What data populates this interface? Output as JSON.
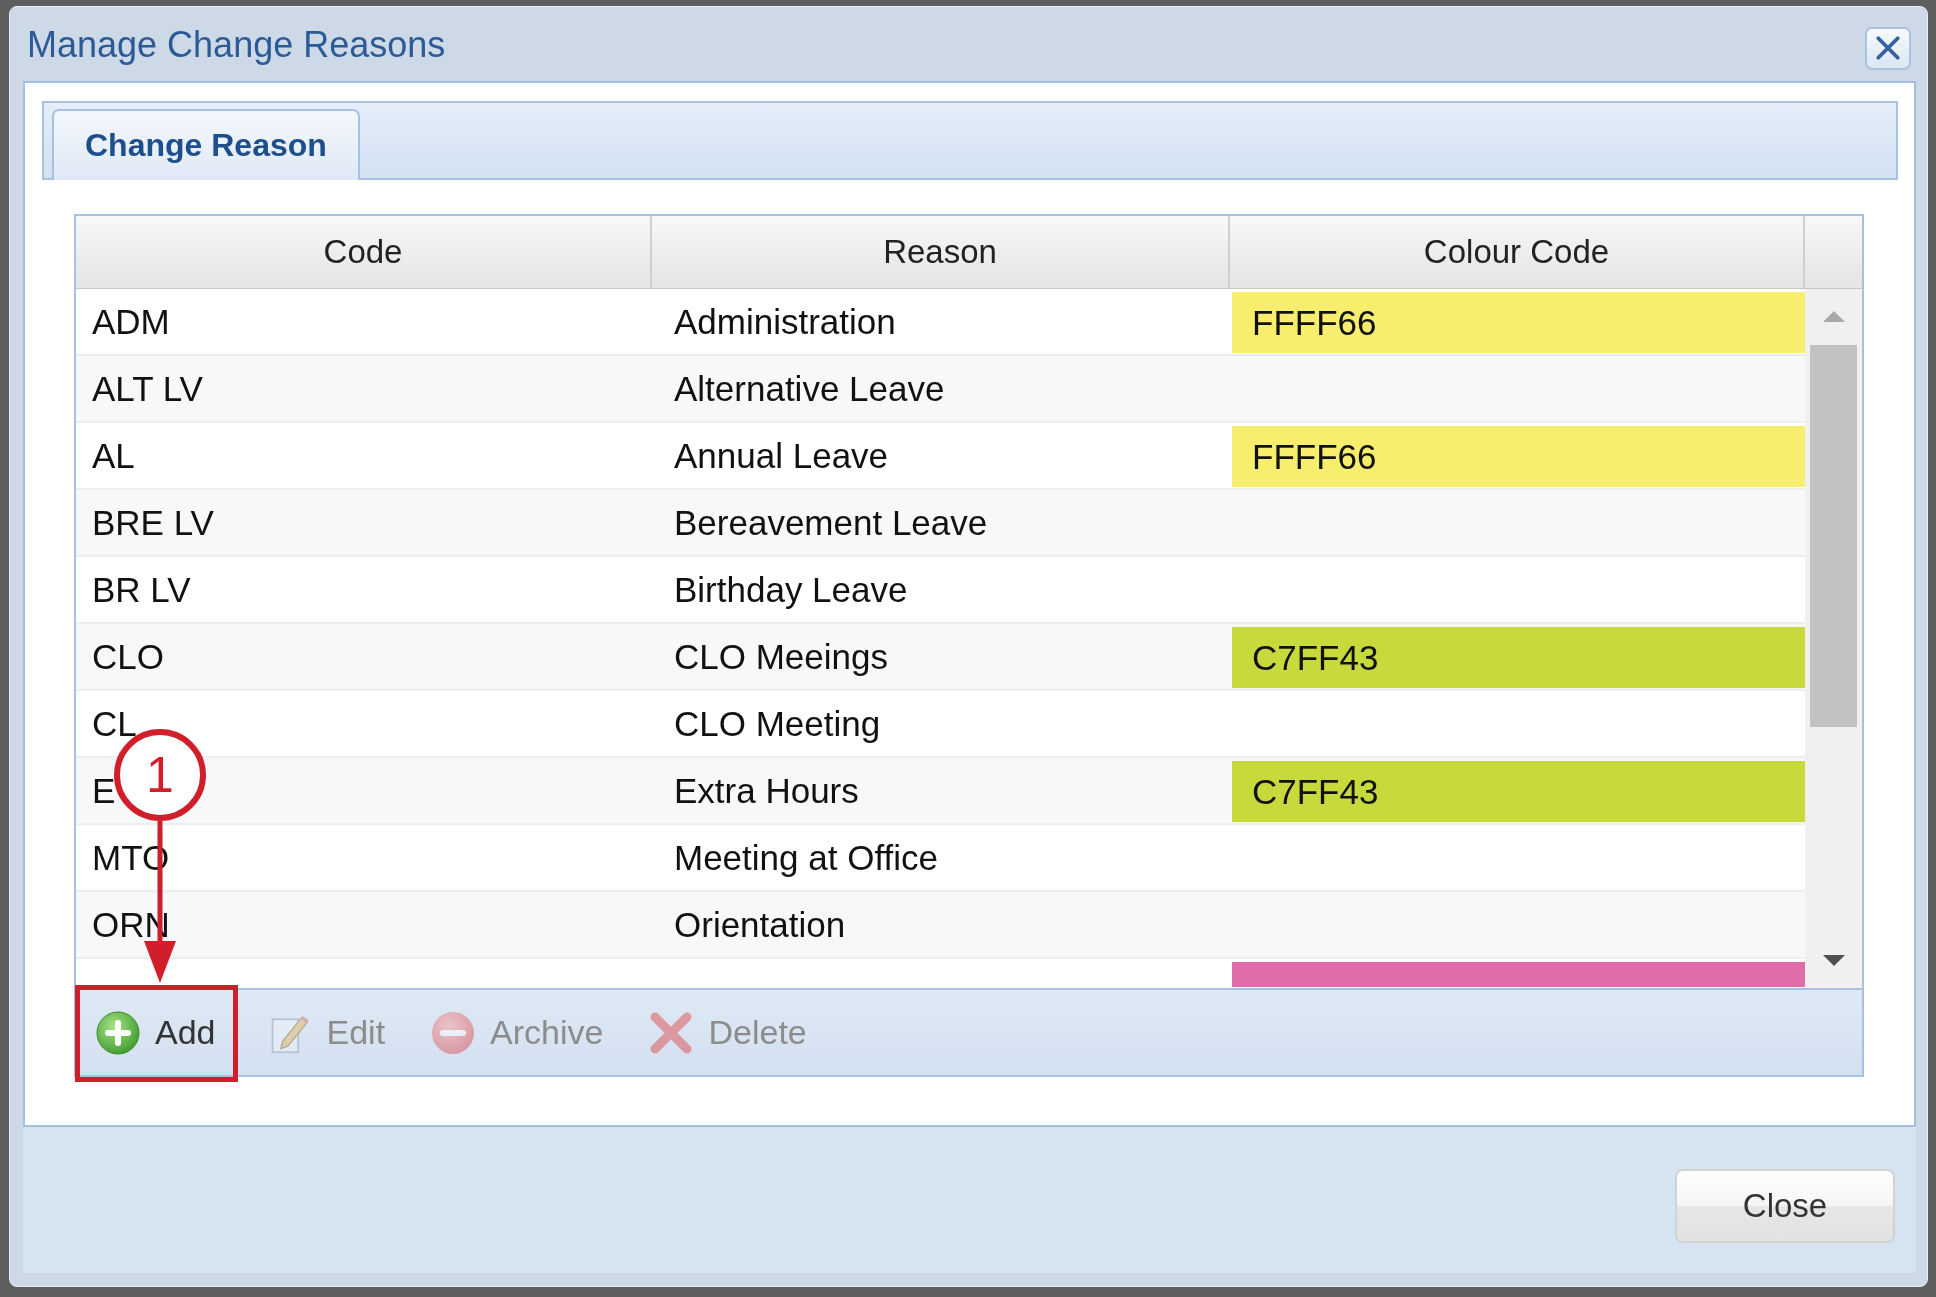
{
  "window": {
    "title": "Manage Change Reasons"
  },
  "tabs": [
    {
      "label": "Change Reason",
      "selected": true
    }
  ],
  "table": {
    "columns": [
      "Code",
      "Reason",
      "Colour Code"
    ],
    "rows": [
      {
        "code": "ADM",
        "reason": "Administration",
        "colour_code": "FFFF66",
        "color": "#f8ee6e"
      },
      {
        "code": "ALT LV",
        "reason": "Alternative Leave"
      },
      {
        "code": "AL",
        "reason": "Annual Leave",
        "colour_code": "FFFF66",
        "color": "#f8ee6e"
      },
      {
        "code": "BRE LV",
        "reason": "Bereavement Leave"
      },
      {
        "code": "BR LV",
        "reason": "Birthday Leave"
      },
      {
        "code": "CLO",
        "reason": "CLO Meeings",
        "colour_code": "C7FF43",
        "color": "#c8da3b"
      },
      {
        "code": "CL",
        "reason": "CLO Meeting"
      },
      {
        "code": "E",
        "reason": "Extra Hours",
        "colour_code": "C7FF43",
        "color": "#c8da3b"
      },
      {
        "code": "MTO",
        "reason": "Meeting at Office"
      },
      {
        "code": "ORN",
        "reason": "Orientation"
      }
    ],
    "cut_off_row": {
      "color": "#e06ca9"
    }
  },
  "toolbar": [
    {
      "label": "Add",
      "kind": "add",
      "disabled": false
    },
    {
      "label": "Edit",
      "kind": "edit",
      "disabled": true
    },
    {
      "label": "Archive",
      "kind": "archive",
      "disabled": true
    },
    {
      "label": "Delete",
      "kind": "delete",
      "disabled": true
    }
  ],
  "callout": {
    "number": "1"
  },
  "buttons": [
    "Close"
  ]
}
